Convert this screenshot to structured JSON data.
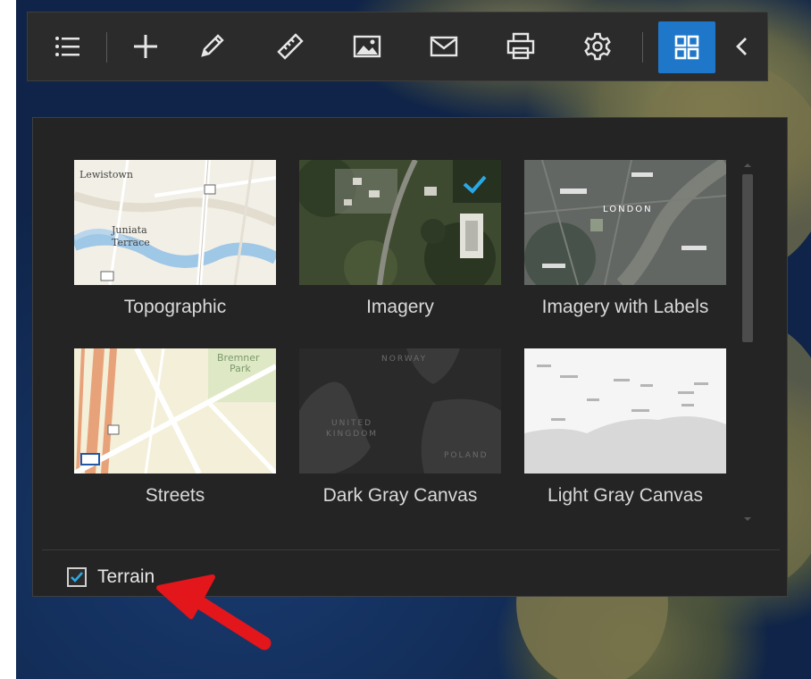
{
  "toolbar": {
    "buttons": [
      {
        "name": "layer-list",
        "icon": "list-icon"
      },
      {
        "name": "add",
        "icon": "plus-icon"
      },
      {
        "name": "draw",
        "icon": "pencil-icon"
      },
      {
        "name": "measure",
        "icon": "ruler-icon"
      },
      {
        "name": "basemap-image",
        "icon": "image-icon"
      },
      {
        "name": "share",
        "icon": "mail-icon"
      },
      {
        "name": "print",
        "icon": "printer-icon"
      },
      {
        "name": "settings",
        "icon": "gear-icon"
      },
      {
        "name": "basemap-gallery",
        "icon": "grid-icon",
        "active": true
      },
      {
        "name": "collapse",
        "icon": "chevron-left-icon"
      }
    ],
    "active_color": "#1f77c9"
  },
  "gallery": {
    "tiles": [
      {
        "label": "Topographic",
        "thumb_text": [
          "Lewistown",
          "Juniata",
          "Terrace"
        ]
      },
      {
        "label": "Imagery",
        "selected": true
      },
      {
        "label": "Imagery with Labels",
        "thumb_text": [
          "LONDON"
        ]
      },
      {
        "label": "Streets",
        "thumb_text": [
          "Bremner",
          "Park"
        ]
      },
      {
        "label": "Dark Gray Canvas",
        "thumb_text": [
          "NORWAY",
          "UNITED",
          "KINGDOM",
          "POLAND"
        ]
      },
      {
        "label": "Light Gray Canvas"
      }
    ],
    "selected_check_color": "#2aa8e6"
  },
  "terrain": {
    "label": "Terrain",
    "checked": true
  },
  "annotation": {
    "arrow_color": "#e3161b"
  }
}
